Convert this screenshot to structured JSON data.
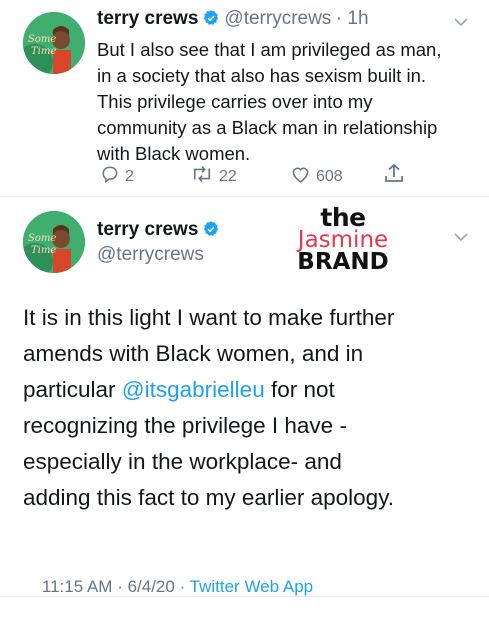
{
  "tweet1": {
    "author_name": "terry crews",
    "author_handle": "@terrycrews",
    "time": "· 1h",
    "text_lines": [
      "But I also see that I am privileged as man,",
      "in a society that also has sexism built in.",
      "This privilege carries over into my",
      "community as a Black man in relationship",
      "with Black women."
    ],
    "replies": "2",
    "retweets": "22",
    "likes": "608"
  },
  "tweet2": {
    "author_name": "terry crews",
    "author_handle": "@terrycrews",
    "text_before_mention_lines": [
      "It is in this light I want to make further",
      "amends with Black women, and in",
      "particular "
    ],
    "mention": "@itsgabrielleu",
    "text_after_mention": " for not",
    "text_after_lines": [
      "recognizing the privilege I have -",
      "especially in the workplace- and",
      "adding this fact to my earlier apology."
    ],
    "timestamp": "11:15 AM · 6/4/20 · ",
    "source": "Twitter Web App"
  },
  "watermark": {
    "line1": "the",
    "line2": "Jasmine",
    "line3": "BRAND"
  },
  "colors": {
    "accent": "#1da1f2",
    "muted": "#657786",
    "text": "#14171a",
    "watermark_red": "#e8374d",
    "divider": "#e6ecf0"
  },
  "icons": {
    "verified": "verified-badge-icon",
    "chevron": "chevron-down-icon",
    "reply": "reply-icon",
    "retweet": "retweet-icon",
    "like": "heart-icon",
    "share": "share-icon"
  }
}
